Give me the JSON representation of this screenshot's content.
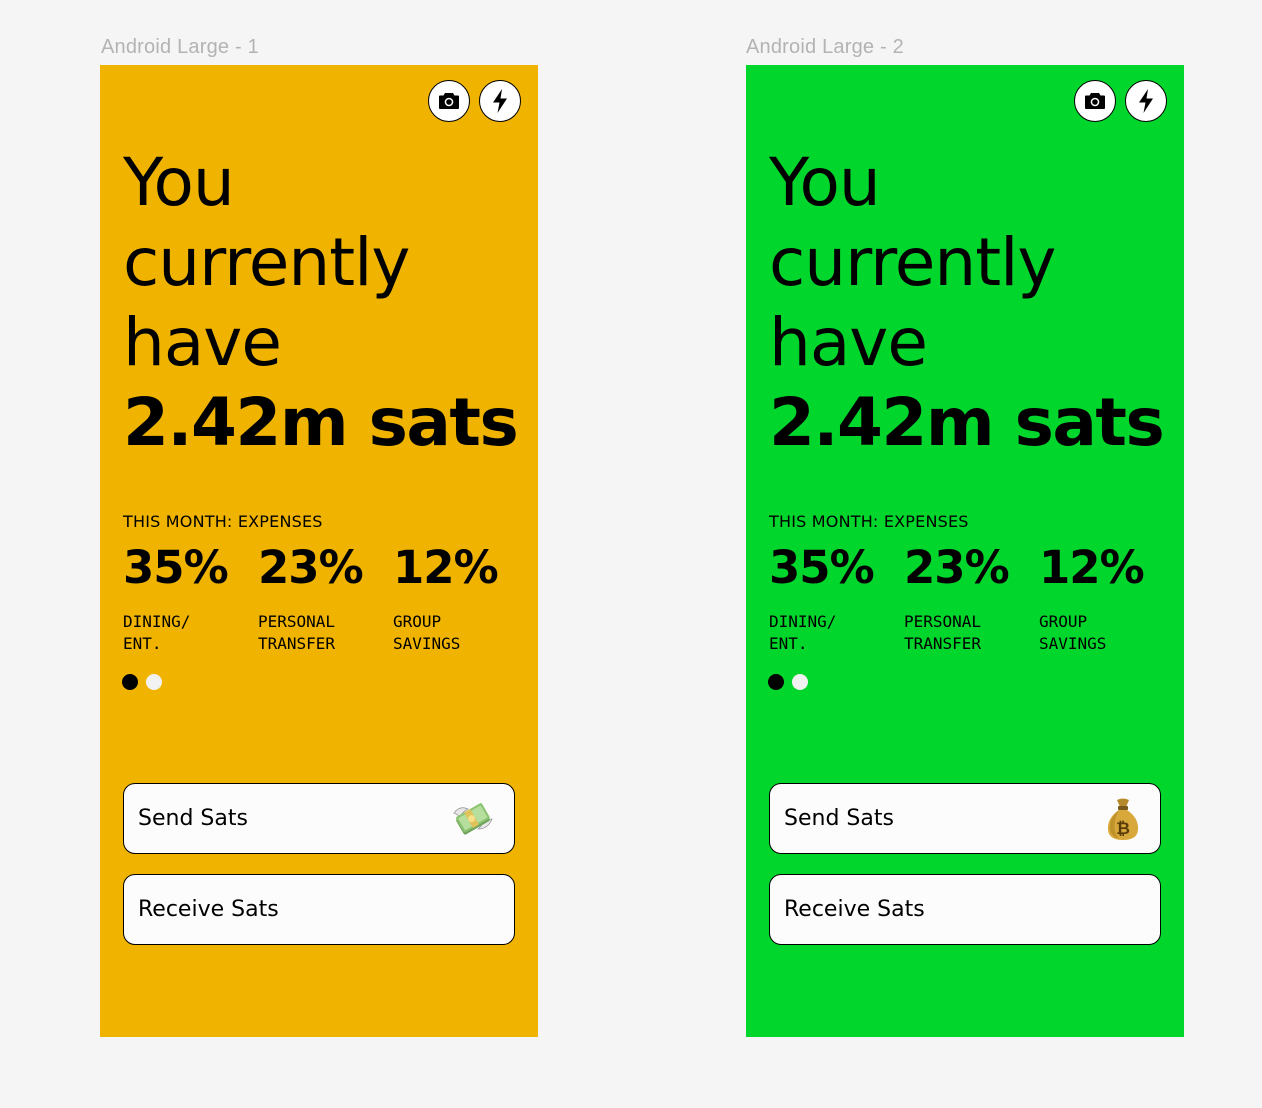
{
  "frames": [
    {
      "label": "Android Large - 1",
      "background": "#f0b400",
      "headline": [
        "You",
        "currently",
        "have"
      ],
      "balance": "2.42m sats",
      "section_label": "THIS MONTH: EXPENSES",
      "stats": [
        {
          "pct": "35%",
          "label": "DINING/\nENT."
        },
        {
          "pct": "23%",
          "label": "PERSONAL\nTRANSFER"
        },
        {
          "pct": "12%",
          "label": "GROUP\nSAVINGS"
        }
      ],
      "send_label": "Send Sats",
      "send_icon": "money-with-wings-icon",
      "receive_label": "Receive Sats",
      "pager": {
        "current": 1,
        "total": 2
      }
    },
    {
      "label": "Android Large - 2",
      "background": "#00d62b",
      "headline": [
        "You",
        "currently",
        "have"
      ],
      "balance": "2.42m sats",
      "section_label": "THIS MONTH: EXPENSES",
      "stats": [
        {
          "pct": "35%",
          "label": "DINING/\nENT."
        },
        {
          "pct": "23%",
          "label": "PERSONAL\nTRANSFER"
        },
        {
          "pct": "12%",
          "label": "GROUP\nSAVINGS"
        }
      ],
      "send_label": "Send Sats",
      "send_icon": "bitcoin-money-bag-icon",
      "receive_label": "Receive Sats",
      "pager": {
        "current": 1,
        "total": 2
      }
    }
  ],
  "icons": {
    "camera": "camera-icon",
    "lightning": "lightning-icon"
  }
}
